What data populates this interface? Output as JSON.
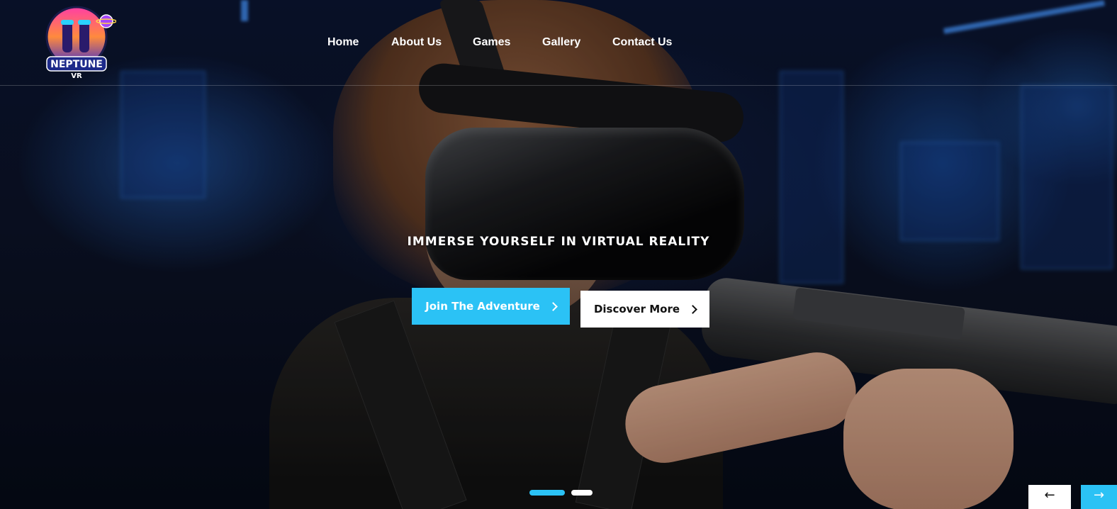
{
  "brand": {
    "logo_text": "NEPTUNE",
    "logo_subtext": "VR"
  },
  "nav": {
    "items": [
      {
        "label": "Home"
      },
      {
        "label": "About Us"
      },
      {
        "label": "Games"
      },
      {
        "label": "Gallery"
      },
      {
        "label": "Contact Us"
      }
    ]
  },
  "hero": {
    "headline": "IMMERSE YOURSELF IN VIRTUAL REALITY",
    "primary_button": "Join The Adventure",
    "secondary_button": "Discover More",
    "slide_count": 2,
    "active_slide": 1
  },
  "colors": {
    "accent": "#2bc2f5",
    "button_light": "#ffffff",
    "text": "#ffffff"
  },
  "icons": {
    "button_chevron": "chevron-right-icon",
    "prev": "arrow-left-icon",
    "next": "arrow-right-icon"
  },
  "carousel": {
    "prev_glyph": "←",
    "next_glyph": "→"
  }
}
